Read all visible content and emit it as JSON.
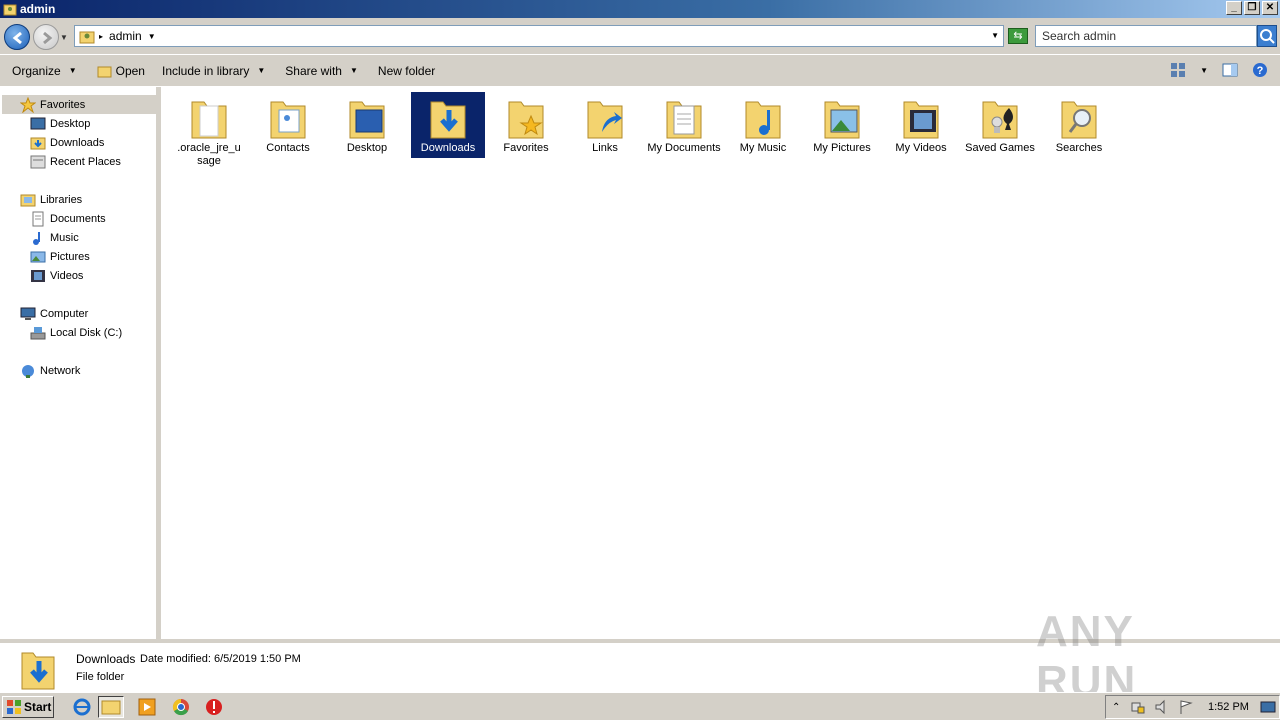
{
  "window": {
    "title": "admin"
  },
  "address": {
    "crumb": "admin",
    "search_placeholder": "Search admin"
  },
  "toolbar": {
    "organize": "Organize",
    "open": "Open",
    "include_in_library": "Include in library",
    "share_with": "Share with",
    "new_folder": "New folder"
  },
  "nav": {
    "favorites": "Favorites",
    "desktop": "Desktop",
    "downloads": "Downloads",
    "recent_places": "Recent Places",
    "libraries": "Libraries",
    "documents": "Documents",
    "music": "Music",
    "pictures": "Pictures",
    "videos": "Videos",
    "computer": "Computer",
    "local_disk": "Local Disk (C:)",
    "network": "Network"
  },
  "items": [
    {
      "label": ".oracle_jre_u sage",
      "icon": "folder-blank-icon"
    },
    {
      "label": "Contacts",
      "icon": "folder-contacts-icon"
    },
    {
      "label": "Desktop",
      "icon": "folder-desktop-icon"
    },
    {
      "label": "Downloads",
      "icon": "folder-downloads-icon",
      "selected": true
    },
    {
      "label": "Favorites",
      "icon": "folder-favorites-icon"
    },
    {
      "label": "Links",
      "icon": "folder-links-icon"
    },
    {
      "label": "My Documents",
      "icon": "folder-documents-icon"
    },
    {
      "label": "My Music",
      "icon": "folder-music-icon"
    },
    {
      "label": "My Pictures",
      "icon": "folder-pictures-icon"
    },
    {
      "label": "My Videos",
      "icon": "folder-videos-icon"
    },
    {
      "label": "Saved Games",
      "icon": "folder-games-icon"
    },
    {
      "label": "Searches",
      "icon": "folder-searches-icon"
    }
  ],
  "details": {
    "name": "Downloads",
    "modified_label": "Date modified:",
    "modified_value": "6/5/2019 1:50 PM",
    "type": "File folder"
  },
  "watermark": "ANY RUN",
  "taskbar": {
    "start": "Start",
    "clock": "1:52 PM"
  },
  "colors": {
    "selection": "#0a246a",
    "chrome": "#d4d0c8",
    "folder": "#f3d36f"
  }
}
